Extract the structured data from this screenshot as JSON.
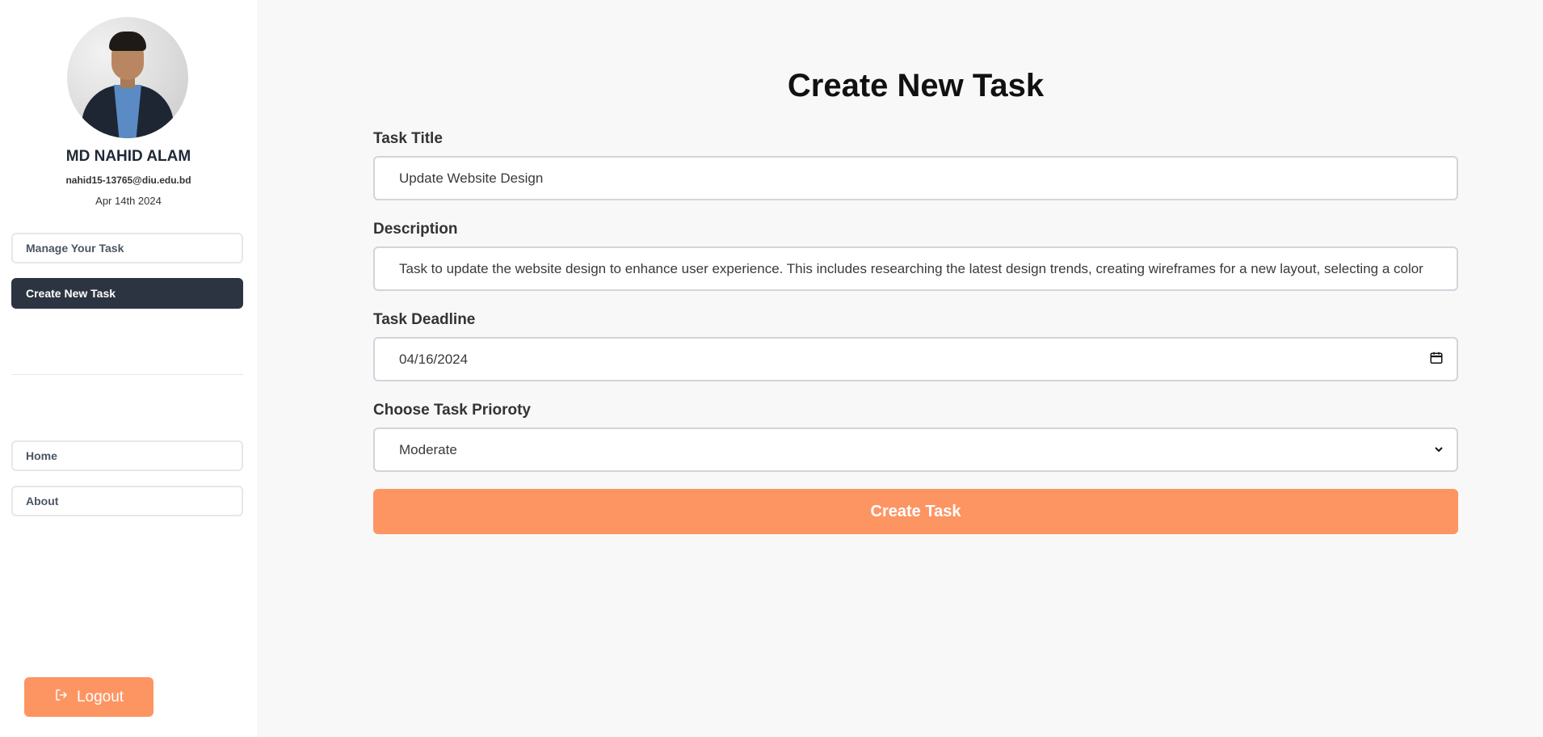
{
  "profile": {
    "name": "MD NAHID ALAM",
    "email": "nahid15-13765@diu.edu.bd",
    "date": "Apr 14th 2024"
  },
  "sidebar": {
    "top_items": [
      {
        "label": "Manage Your Task",
        "active": false
      },
      {
        "label": "Create New Task",
        "active": true
      }
    ],
    "bottom_items": [
      {
        "label": "Home"
      },
      {
        "label": "About"
      }
    ],
    "logout_label": "Logout"
  },
  "form": {
    "title": "Create New Task",
    "task_title_label": "Task Title",
    "task_title_value": "Update Website Design",
    "description_label": "Description",
    "description_value": "Task to update the website design to enhance user experience. This includes researching the latest design trends, creating wireframes for a new layout, selecting a color",
    "deadline_label": "Task Deadline",
    "deadline_value": "04/16/2024",
    "priority_label": "Choose Task Prioroty",
    "priority_value": "Moderate",
    "submit_label": "Create Task"
  },
  "colors": {
    "accent": "#fd9563",
    "active_nav": "#2d3441"
  },
  "icons": {
    "logout": "logout-icon",
    "calendar": "calendar-icon",
    "dropdown": "chevron-down-icon"
  }
}
